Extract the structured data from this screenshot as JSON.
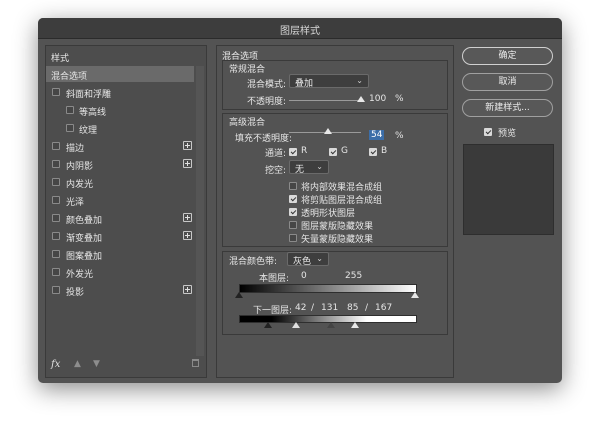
{
  "window": {
    "title": "图层样式"
  },
  "left": {
    "header": "样式",
    "items": [
      {
        "label": "混合选项"
      },
      {
        "label": "斜面和浮雕"
      },
      {
        "label": "等高线"
      },
      {
        "label": "纹理"
      },
      {
        "label": "描边"
      },
      {
        "label": "内阴影"
      },
      {
        "label": "内发光"
      },
      {
        "label": "光泽"
      },
      {
        "label": "颜色叠加"
      },
      {
        "label": "渐变叠加"
      },
      {
        "label": "图案叠加"
      },
      {
        "label": "外发光"
      },
      {
        "label": "投影"
      }
    ],
    "fx_label": "fx"
  },
  "blend": {
    "section_title": "混合选项",
    "normal_title": "常规混合",
    "mode_label": "混合模式:",
    "mode_value": "叠加",
    "opacity_label": "不透明度:",
    "opacity_value": "100",
    "opacity_pct": 100,
    "percent": "%",
    "advanced_title": "高级混合",
    "fill_label": "填充不透明度:",
    "fill_value": "54",
    "fill_pct": 54,
    "channels_label": "通道:",
    "ch_r": "R",
    "ch_g": "G",
    "ch_b": "B",
    "knockout_label": "挖空:",
    "knockout_value": "无",
    "opts": [
      {
        "label": "将内部效果混合成组",
        "checked": false
      },
      {
        "label": "将剪贴图层混合成组",
        "checked": true
      },
      {
        "label": "透明形状图层",
        "checked": true
      },
      {
        "label": "图层蒙版隐藏效果",
        "checked": false
      },
      {
        "label": "矢量蒙版隐藏效果",
        "checked": false
      }
    ],
    "blendif_label": "混合颜色带:",
    "blendif_value": "灰色",
    "this_layer_label": "本图层:",
    "this_low": "0",
    "this_high": "255",
    "under_label": "下一图层:",
    "under_a": "42",
    "sep1": "/",
    "under_b": "131",
    "under_c": "85",
    "sep2": "/",
    "under_d": "167"
  },
  "buttons": {
    "ok": "确定",
    "cancel": "取消",
    "new_style": "新建样式...",
    "preview": "预览"
  }
}
